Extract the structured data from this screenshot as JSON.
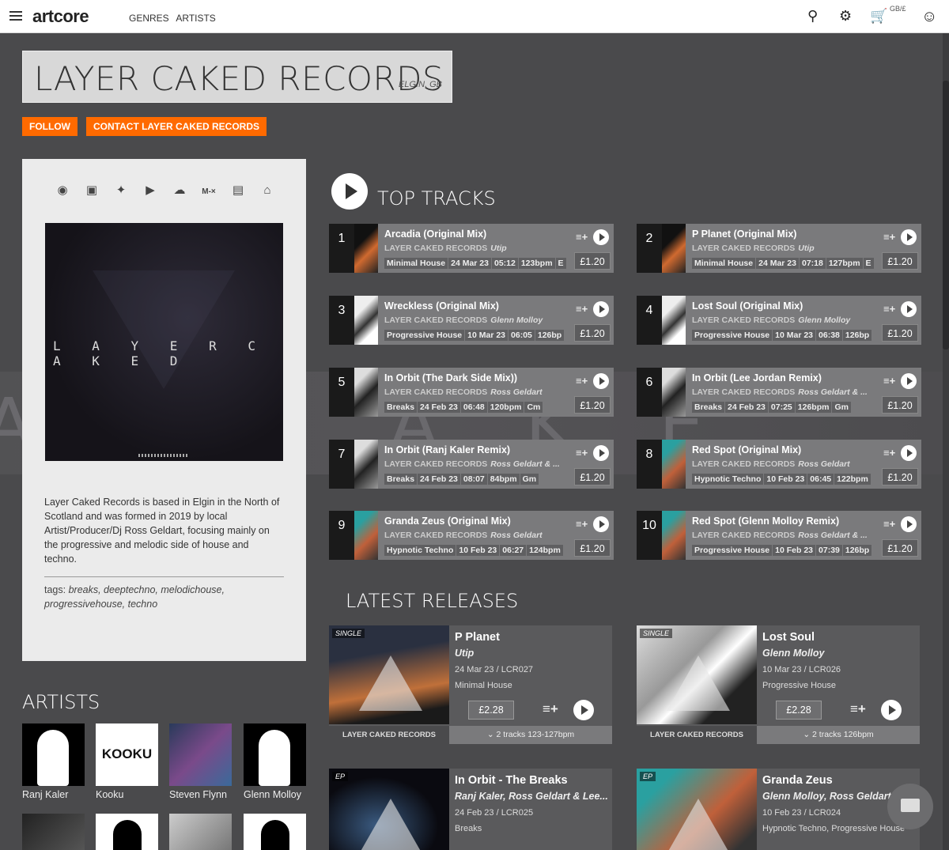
{
  "header": {
    "logo": "artcore",
    "nav": [
      "GENRES",
      "ARTISTS"
    ],
    "currency": "GB/£"
  },
  "label": {
    "name": "LAYER CAKED RECORDS",
    "location": "ELGIN, GB",
    "follow_label": "FOLLOW",
    "contact_label": "CONTACT LAYER CAKED RECORDS",
    "social": [
      "facebook-icon",
      "instagram-icon",
      "twitter-icon",
      "youtube-icon",
      "soundcloud-icon",
      "mixcloud-icon",
      "twitch-icon",
      "home-icon"
    ],
    "mixcloud_glyph": "M-×",
    "art_text": "L A Y E R C A K E D",
    "bio": "Layer Caked Records is based in Elgin in the North of Scotland and was formed in 2019 by local Artist/Producer/Dj Ross Geldart, focusing mainly on the progressive and melodic side of house and techno.",
    "tags_prefix": "tags:",
    "tags": "breaks, deeptechno, melodichouse, progressivehouse, techno"
  },
  "sections": {
    "artists": "ARTISTS",
    "top_tracks": "TOP TRACKS",
    "latest_releases": "LATEST RELEASES"
  },
  "artists": [
    {
      "name": "Ranj Kaler"
    },
    {
      "name": "Kooku",
      "logo": "KOOKU"
    },
    {
      "name": "Steven Flynn"
    },
    {
      "name": "Glenn Molloy"
    }
  ],
  "tracks": [
    {
      "num": "1",
      "title": "Arcadia (Original Mix)",
      "label": "LAYER CAKED RECORDS",
      "artist": "Utip",
      "genre": "Minimal House",
      "date": "24 Mar 23",
      "length": "05:12",
      "bpm": "123bpm",
      "key": "E",
      "price": "£1.20"
    },
    {
      "num": "2",
      "title": "P Planet (Original Mix)",
      "label": "LAYER CAKED RECORDS",
      "artist": "Utip",
      "genre": "Minimal House",
      "date": "24 Mar 23",
      "length": "07:18",
      "bpm": "127bpm",
      "key": "E",
      "price": "£1.20"
    },
    {
      "num": "3",
      "title": "Wreckless (Original Mix)",
      "label": "LAYER CAKED RECORDS",
      "artist": "Glenn Molloy",
      "genre": "Progressive House",
      "date": "10 Mar 23",
      "length": "06:05",
      "bpm": "126bp",
      "key": "",
      "price": "£1.20"
    },
    {
      "num": "4",
      "title": "Lost Soul (Original Mix)",
      "label": "LAYER CAKED RECORDS",
      "artist": "Glenn Molloy",
      "genre": "Progressive House",
      "date": "10 Mar 23",
      "length": "06:38",
      "bpm": "126bp",
      "key": "",
      "price": "£1.20"
    },
    {
      "num": "5",
      "title": "In Orbit (The Dark Side Mix))",
      "label": "LAYER CAKED RECORDS",
      "artist": "Ross Geldart",
      "genre": "Breaks",
      "date": "24 Feb 23",
      "length": "06:48",
      "bpm": "120bpm",
      "key": "Cm",
      "price": "£1.20"
    },
    {
      "num": "6",
      "title": "In Orbit (Lee Jordan Remix)",
      "label": "LAYER CAKED RECORDS",
      "artist": "Ross Geldart & ...",
      "genre": "Breaks",
      "date": "24 Feb 23",
      "length": "07:25",
      "bpm": "126bpm",
      "key": "Gm",
      "price": "£1.20"
    },
    {
      "num": "7",
      "title": "In Orbit (Ranj Kaler Remix)",
      "label": "LAYER CAKED RECORDS",
      "artist": "Ross Geldart & ...",
      "genre": "Breaks",
      "date": "24 Feb 23",
      "length": "08:07",
      "bpm": "84bpm",
      "key": "Gm",
      "price": "£1.20"
    },
    {
      "num": "8",
      "title": "Red Spot (Original Mix)",
      "label": "LAYER CAKED RECORDS",
      "artist": "Ross Geldart",
      "genre": "Hypnotic Techno",
      "date": "10 Feb 23",
      "length": "06:45",
      "bpm": "122bpm",
      "key": "",
      "price": "£1.20"
    },
    {
      "num": "9",
      "title": "Granda Zeus (Original Mix)",
      "label": "LAYER CAKED RECORDS",
      "artist": "Ross Geldart",
      "genre": "Hypnotic Techno",
      "date": "10 Feb 23",
      "length": "06:27",
      "bpm": "124bpm",
      "key": "",
      "price": "£1.20"
    },
    {
      "num": "10",
      "title": "Red Spot (Glenn Molloy Remix)",
      "label": "LAYER CAKED RECORDS",
      "artist": "Ross Geldart & ...",
      "genre": "Progressive House",
      "date": "10 Feb 23",
      "length": "07:39",
      "bpm": "126bp",
      "key": "",
      "price": "£1.20"
    }
  ],
  "releases": [
    {
      "badge": "SINGLE",
      "title": "P Planet",
      "artist": "Utip",
      "date": "24 Mar 23 / LCR027",
      "genre": "Minimal House",
      "price": "£2.28",
      "label": "LAYER CAKED RECORDS",
      "tracks": "2 tracks 123-127bpm"
    },
    {
      "badge": "SINGLE",
      "title": "Lost Soul",
      "artist": "Glenn Molloy",
      "date": "10 Mar 23 / LCR026",
      "genre": "Progressive House",
      "price": "£2.28",
      "label": "LAYER CAKED RECORDS",
      "tracks": "2 tracks 126bpm"
    },
    {
      "badge": "EP",
      "title": "In Orbit - The Breaks",
      "artist": "Ranj Kaler, Ross Geldart & Lee...",
      "date": "24 Feb 23 / LCR025",
      "genre": "Breaks",
      "price": "",
      "label": "",
      "tracks": ""
    },
    {
      "badge": "EP",
      "title": "Granda Zeus",
      "artist": "Glenn Molloy, Ross Geldart &",
      "date": "10 Feb 23 / LCR024",
      "genre": "Hypnotic Techno, Progressive House",
      "price": "",
      "label": "",
      "tracks": ""
    }
  ],
  "colors": {
    "accent": "#ff6a00",
    "page_bg": "#4a4a4c",
    "card_bg": "#7a7a7c"
  }
}
